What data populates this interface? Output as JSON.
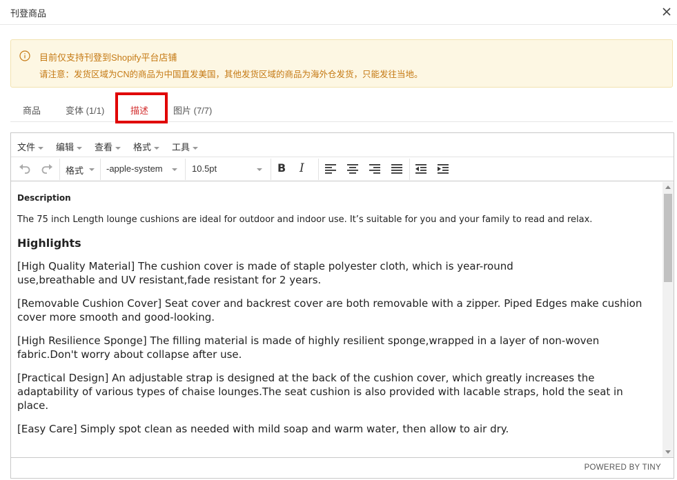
{
  "modal": {
    "title": "刊登商品"
  },
  "notice": {
    "line1": "目前仅支持刊登到Shopify平台店铺",
    "line2": "请注意：发货区域为CN的商品为中国直发美国，其他发货区域的商品为海外仓发货，只能发往当地。",
    "color": "#c57a14",
    "background": "#fdf7e3"
  },
  "tabs": [
    {
      "label": "商品"
    },
    {
      "label": "变体 (1/1)"
    },
    {
      "label": "描述"
    },
    {
      "label": "图片 (7/7)"
    }
  ],
  "active_tab": "描述",
  "editor": {
    "menubar": [
      "文件",
      "编辑",
      "查看",
      "格式",
      "工具"
    ],
    "toolbar": {
      "format_label": "格式",
      "font_family": "-apple-system",
      "font_size": "10.5pt",
      "bold_label": "B",
      "italic_label": "I",
      "icons": [
        "undo-icon",
        "redo-icon",
        "bold-icon",
        "italic-icon",
        "align-left-icon",
        "align-center-icon",
        "align-right-icon",
        "align-justify-icon",
        "outdent-icon",
        "indent-icon"
      ]
    },
    "content": {
      "heading_description": "Description",
      "intro": "The 75 inch Length lounge cushions are ideal for outdoor and indoor use. It’s suitable for you and your family to read and relax.",
      "heading_highlights": "Highlights",
      "paragraphs": [
        "[High Quality Material] The cushion cover is made of staple polyester cloth, which is year-round use,breathable and UV resistant,fade resistant for 2 years.",
        "[Removable Cushion Cover] Seat cover and backrest cover are both removable with a zipper. Piped Edges make cushion cover more smooth and good-looking.",
        "[High Resilience Sponge] The filling material is made of highly resilient sponge,wrapped in a layer of non-woven fabric.Don't worry about collapse after use.",
        "[Practical Design] An adjustable strap is designed at the back of the cushion cover, which greatly increases the adaptability of various types of chaise lounges.The seat cushion is also provided with lacable straps, hold the seat in place.",
        "[Easy Care] Simply spot clean as needed with mild soap and warm water, then allow to air dry."
      ]
    },
    "statusbar": "POWERED BY TINY"
  },
  "colors": {
    "active_tab": "#d32f2f",
    "highlight_box": "#e00000"
  }
}
